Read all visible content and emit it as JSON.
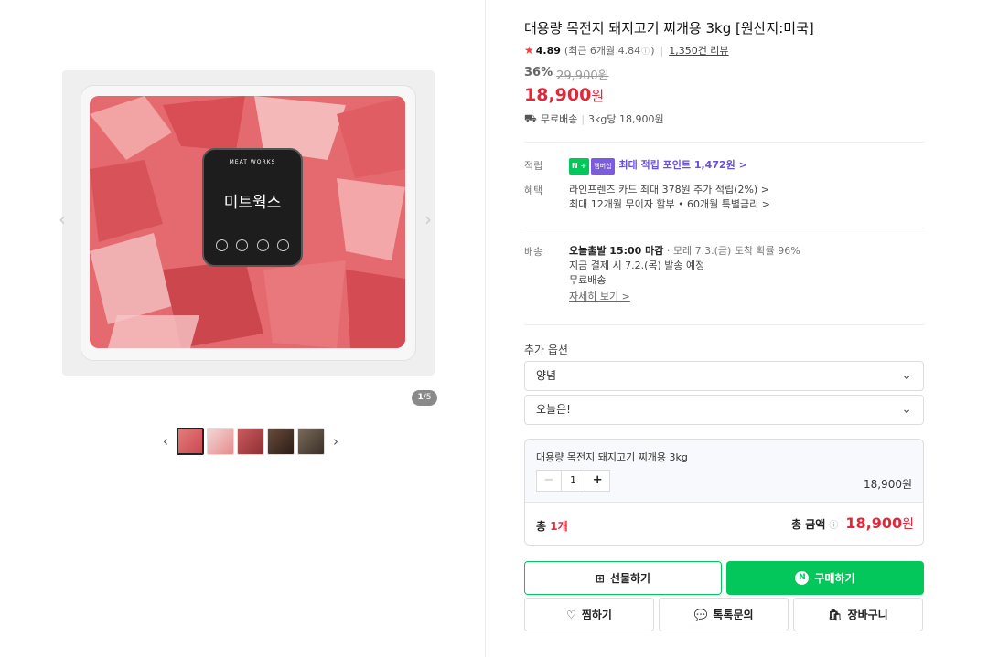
{
  "gallery": {
    "label_brand_small": "MEAT WORKS",
    "label_brand_big": "미트웍스",
    "counter_current": "1",
    "counter_total": "/5",
    "prev_icon": "chevron-left-icon",
    "next_icon": "chevron-right-icon"
  },
  "product": {
    "title": "대용량 목전지 돼지고기 찌개용 3kg [원산지:미국]",
    "rating": "4.89",
    "rating_recent": "(최근 6개월 4.84",
    "rating_recent_end": ")",
    "review_count": "1,350건 리뷰",
    "discount": "36%",
    "original_price": "29,900원",
    "price": "18,900",
    "price_unit": "원",
    "shipping": "무료배송",
    "unit_price": "3kg당 18,900원"
  },
  "benefits": {
    "points_key": "적립",
    "npay_badge": "N +",
    "membership_badge": "멤버십",
    "points_text": "최대 적립 포인트 1,472원 >",
    "benefit_key": "혜택",
    "benefit_line1": "라인프렌즈 카드 최대 378원 추가 적립(2%) >",
    "benefit_line2": "최대 12개월 무이자 할부 • 60개월 특별금리 >"
  },
  "delivery": {
    "key": "배송",
    "today": "오늘출발 15:00 마감",
    "eta": "· 모레 7.3.(금) 도착 확률 96%",
    "pay_now": "지금 결제 시 7.2.(목) 발송 예정",
    "free": "무료배송",
    "details": "자세히 보기 >"
  },
  "options": {
    "title": "추가 옵션",
    "option1": "양념",
    "option2": "오늘은!"
  },
  "selection": {
    "name": "대용량 목전지 돼지고기 찌개용 3kg",
    "quantity": "1",
    "minus": "−",
    "plus": "+",
    "price": "18,900원",
    "total_label": "총",
    "total_count": "1개",
    "total_amount_label": "총 금액",
    "total_amount": "18,900",
    "total_unit": "원"
  },
  "buttons": {
    "gift": "선물하기",
    "buy": "구매하기",
    "buy_badge": "N",
    "wish": "찜하기",
    "talk": "톡톡문의",
    "cart": "장바구니"
  },
  "colors": {
    "accent_green": "#03c75a",
    "price_red": "#e0283a",
    "point_purple": "#6a4ede"
  }
}
